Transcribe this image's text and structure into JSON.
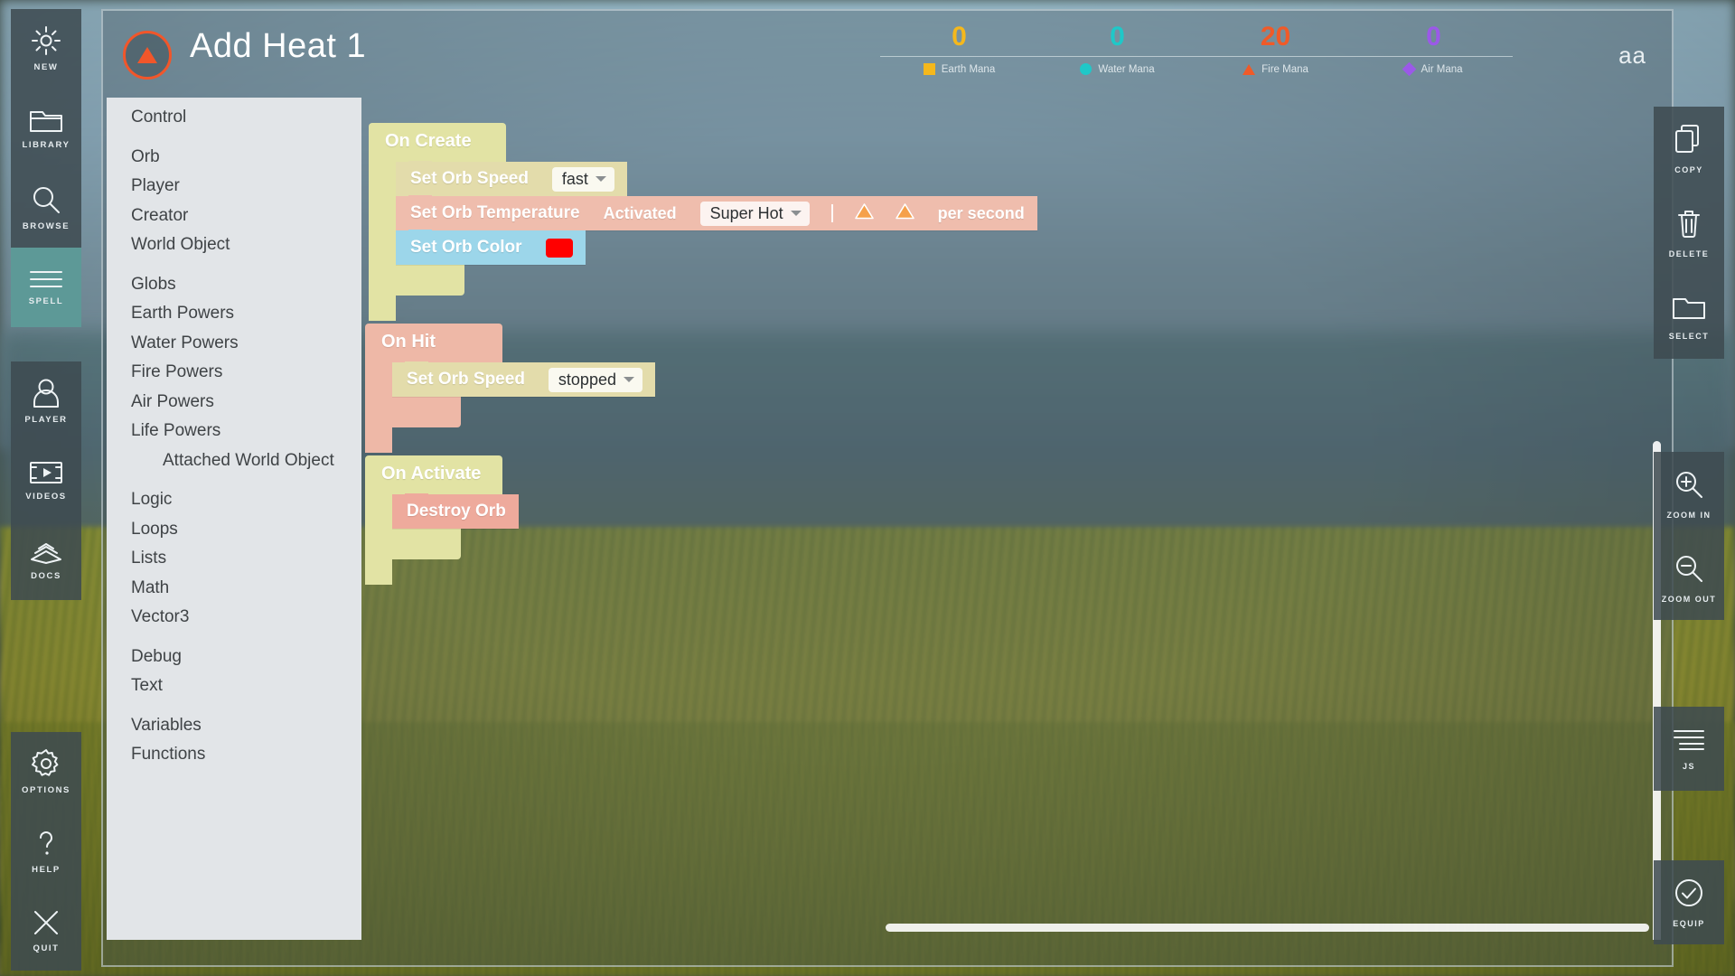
{
  "left_rail": {
    "groups": [
      {
        "items": [
          {
            "icon": "sun-icon",
            "label": "NEW",
            "active": false
          },
          {
            "icon": "folder-icon",
            "label": "LIBRARY",
            "active": false
          },
          {
            "icon": "search-icon",
            "label": "BROWSE",
            "active": false
          },
          {
            "icon": "lines-icon",
            "label": "SPELL",
            "active": true
          }
        ]
      },
      {
        "items": [
          {
            "icon": "person-icon",
            "label": "PLAYER",
            "active": false
          },
          {
            "icon": "film-icon",
            "label": "VIDEOS",
            "active": false
          },
          {
            "icon": "book-icon",
            "label": "DOCS",
            "active": false
          }
        ]
      },
      {
        "items": [
          {
            "icon": "gear-icon",
            "label": "OPTIONS",
            "active": false
          },
          {
            "icon": "question-icon",
            "label": "HELP",
            "active": false
          },
          {
            "icon": "x-icon",
            "label": "QUIT",
            "active": false
          }
        ]
      }
    ]
  },
  "header": {
    "spell_icon": "fire-triangle-icon",
    "spell_icon_color": "#f2562a",
    "title": "Add Heat 1",
    "text_size_button": "aa",
    "mana": [
      {
        "label": "Earth Mana",
        "value": "0",
        "color": "#f5b81c",
        "shape": "square"
      },
      {
        "label": "Water Mana",
        "value": "0",
        "color": "#1fc8c8",
        "shape": "circle"
      },
      {
        "label": "Fire Mana",
        "value": "20",
        "color": "#f05a28",
        "shape": "triangle"
      },
      {
        "label": "Air Mana",
        "value": "0",
        "color": "#9b59e8",
        "shape": "diamond"
      }
    ]
  },
  "categories": [
    {
      "label": "Control",
      "gap": false,
      "indent": false
    },
    {
      "label": "Orb",
      "gap": true,
      "indent": false
    },
    {
      "label": "Player",
      "gap": false,
      "indent": false
    },
    {
      "label": "Creator",
      "gap": false,
      "indent": false
    },
    {
      "label": "World Object",
      "gap": false,
      "indent": false
    },
    {
      "label": "Globs",
      "gap": true,
      "indent": false
    },
    {
      "label": "Earth Powers",
      "gap": false,
      "indent": false
    },
    {
      "label": "Water Powers",
      "gap": false,
      "indent": false
    },
    {
      "label": "Fire Powers",
      "gap": false,
      "indent": false
    },
    {
      "label": "Air Powers",
      "gap": false,
      "indent": false
    },
    {
      "label": "Life Powers",
      "gap": false,
      "indent": false
    },
    {
      "label": "Attached World Object",
      "gap": false,
      "indent": true
    },
    {
      "label": "Logic",
      "gap": true,
      "indent": false
    },
    {
      "label": "Loops",
      "gap": false,
      "indent": false
    },
    {
      "label": "Lists",
      "gap": false,
      "indent": false
    },
    {
      "label": "Math",
      "gap": false,
      "indent": false
    },
    {
      "label": "Vector3",
      "gap": false,
      "indent": false
    },
    {
      "label": "Debug",
      "gap": true,
      "indent": false
    },
    {
      "label": "Text",
      "gap": false,
      "indent": false
    },
    {
      "label": "Variables",
      "gap": true,
      "indent": false
    },
    {
      "label": "Functions",
      "gap": false,
      "indent": false
    }
  ],
  "script": {
    "blocks": [
      {
        "event": "On Create",
        "event_color": "#e2e3a4",
        "statements": [
          {
            "name": "Set Orb Speed",
            "color": "#e3dcab",
            "fields": [
              {
                "kind": "dropdown",
                "value": "fast"
              }
            ]
          },
          {
            "name": "Set Orb Temperature",
            "color": "#efbdad",
            "fields": [
              {
                "kind": "text",
                "value": "Activated"
              },
              {
                "kind": "dropdown",
                "value": "Super Hot"
              },
              {
                "kind": "divider",
                "value": "|"
              },
              {
                "kind": "warning",
                "value": "warning-triangle-icon"
              },
              {
                "kind": "warning",
                "value": "warning-triangle-icon"
              },
              {
                "kind": "text",
                "value": "per second"
              }
            ]
          },
          {
            "name": "Set Orb Color",
            "color": "#9cd6ea",
            "fields": [
              {
                "kind": "color",
                "value": "#ff0000"
              }
            ]
          }
        ]
      },
      {
        "event": "On Hit",
        "event_color": "#eeb8a7",
        "statements": [
          {
            "name": "Set Orb Speed",
            "color": "#e3dcab",
            "fields": [
              {
                "kind": "dropdown",
                "value": "stopped"
              }
            ]
          }
        ]
      },
      {
        "event": "On Activate",
        "event_color": "#e2e3a4",
        "statements": [
          {
            "name": "Destroy Orb",
            "color": "#eeaa9c",
            "fields": []
          }
        ]
      }
    ]
  },
  "right_toolbar": {
    "groups": [
      {
        "items": [
          {
            "icon": "copy-icon",
            "label": "COPY"
          },
          {
            "icon": "trash-icon",
            "label": "DELETE"
          },
          {
            "icon": "select-icon",
            "label": "SELECT"
          }
        ]
      },
      {
        "items": [
          {
            "icon": "zoom-in-icon",
            "label": "ZOOM IN"
          },
          {
            "icon": "zoom-out-icon",
            "label": "ZOOM OUT"
          }
        ]
      },
      {
        "items": [
          {
            "icon": "code-lines-icon",
            "label": "JS"
          }
        ]
      },
      {
        "items": [
          {
            "icon": "check-circle-icon",
            "label": "EQUIP"
          }
        ]
      }
    ]
  }
}
